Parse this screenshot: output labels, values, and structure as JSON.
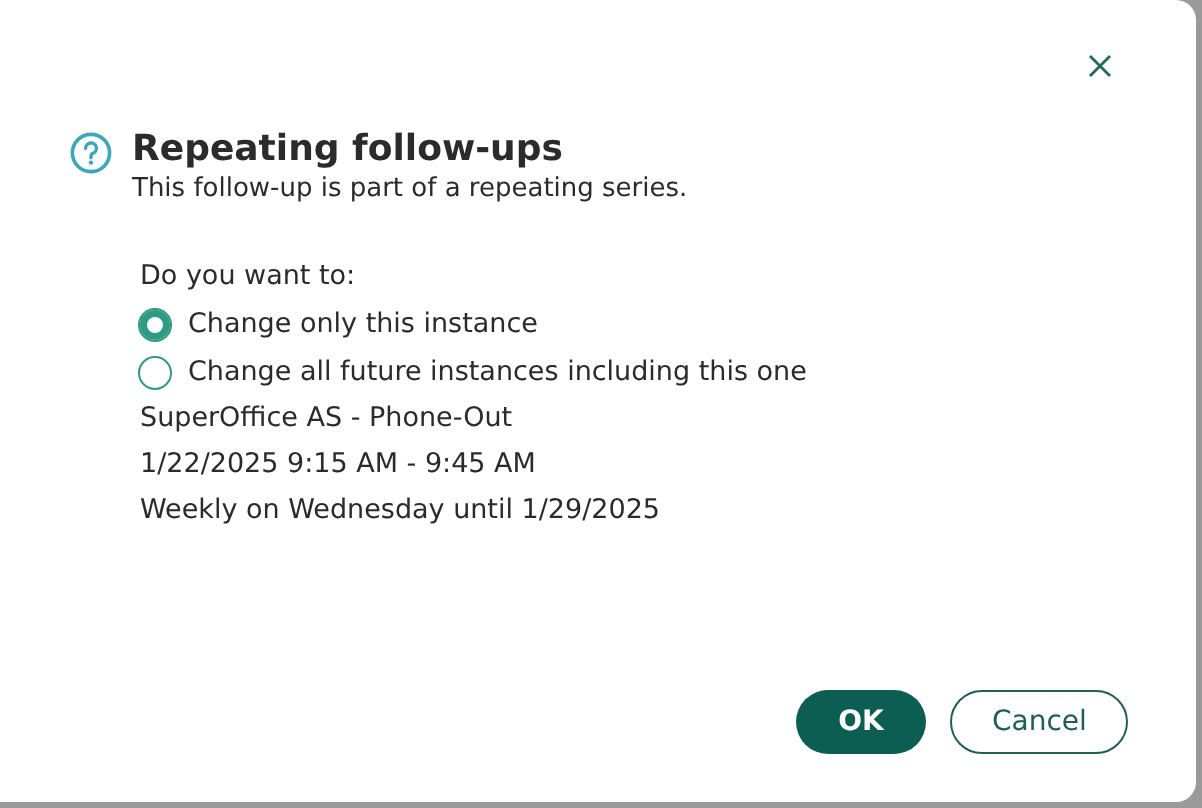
{
  "dialog": {
    "title": "Repeating follow-ups",
    "subtitle": "This follow-up is part of a repeating series.",
    "question": "Do you want to:",
    "options": [
      {
        "label": "Change only this instance",
        "selected": true
      },
      {
        "label": "Change all future instances including this one",
        "selected": false
      }
    ],
    "details": [
      "SuperOffice AS - Phone-Out",
      "1/22/2025 9:15 AM - 9:45 AM",
      "Weekly on Wednesday until 1/29/2025"
    ],
    "buttons": [
      {
        "label": "OK",
        "kind": "primary"
      },
      {
        "label": "Cancel",
        "kind": "secondary"
      }
    ]
  }
}
